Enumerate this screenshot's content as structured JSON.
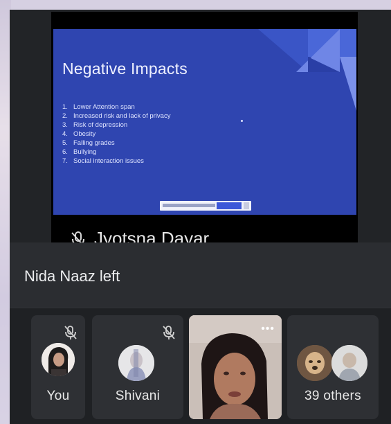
{
  "presentation": {
    "slide_title": "Negative Impacts",
    "items": [
      {
        "num": "1.",
        "text": "Lower Attention span"
      },
      {
        "num": "2.",
        "text": "Increased risk and lack of privacy"
      },
      {
        "num": "3.",
        "text": "Risk of depression"
      },
      {
        "num": "4.",
        "text": "Obesity"
      },
      {
        "num": "5.",
        "text": "Falling grades"
      },
      {
        "num": "6.",
        "text": "Bullying"
      },
      {
        "num": "7.",
        "text": "Social interaction issues"
      }
    ],
    "presenter_name": "Jyotsna Dayar",
    "presenter_icon": "mic-off-icon"
  },
  "notice": {
    "text": "Nida Naaz left"
  },
  "participants": [
    {
      "label": "You",
      "muted": true
    },
    {
      "label": "Shivani",
      "muted": true
    },
    {
      "label": "",
      "muted": false,
      "video": true
    },
    {
      "label": "39 others",
      "muted": false
    }
  ],
  "colors": {
    "slide_background": "#2f45b0",
    "app_background": "#222427",
    "tile_background": "#2e3034"
  }
}
